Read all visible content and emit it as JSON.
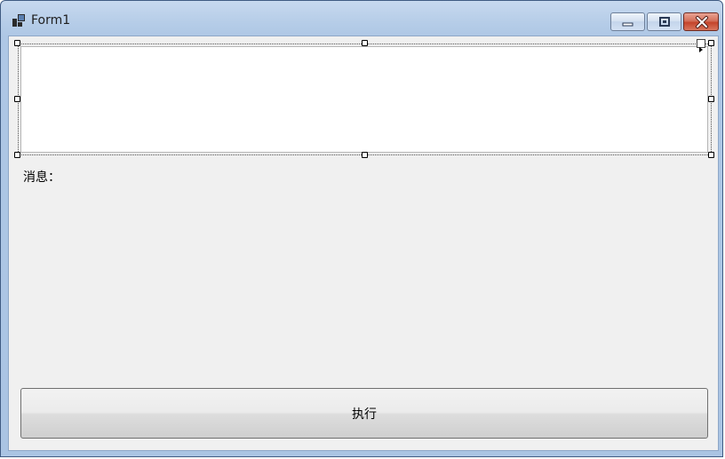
{
  "window": {
    "title": "Form1",
    "icon": "app-icon",
    "controls": [
      "minimize-icon",
      "maximize-icon",
      "close-icon"
    ]
  },
  "form": {
    "textbox_value": "",
    "message_label": "消息：",
    "execute_button_label": "执行"
  },
  "colors": {
    "client_background": "#f0f0f0",
    "titlebar": "#b6cde8",
    "close_button": "#c4442b"
  }
}
